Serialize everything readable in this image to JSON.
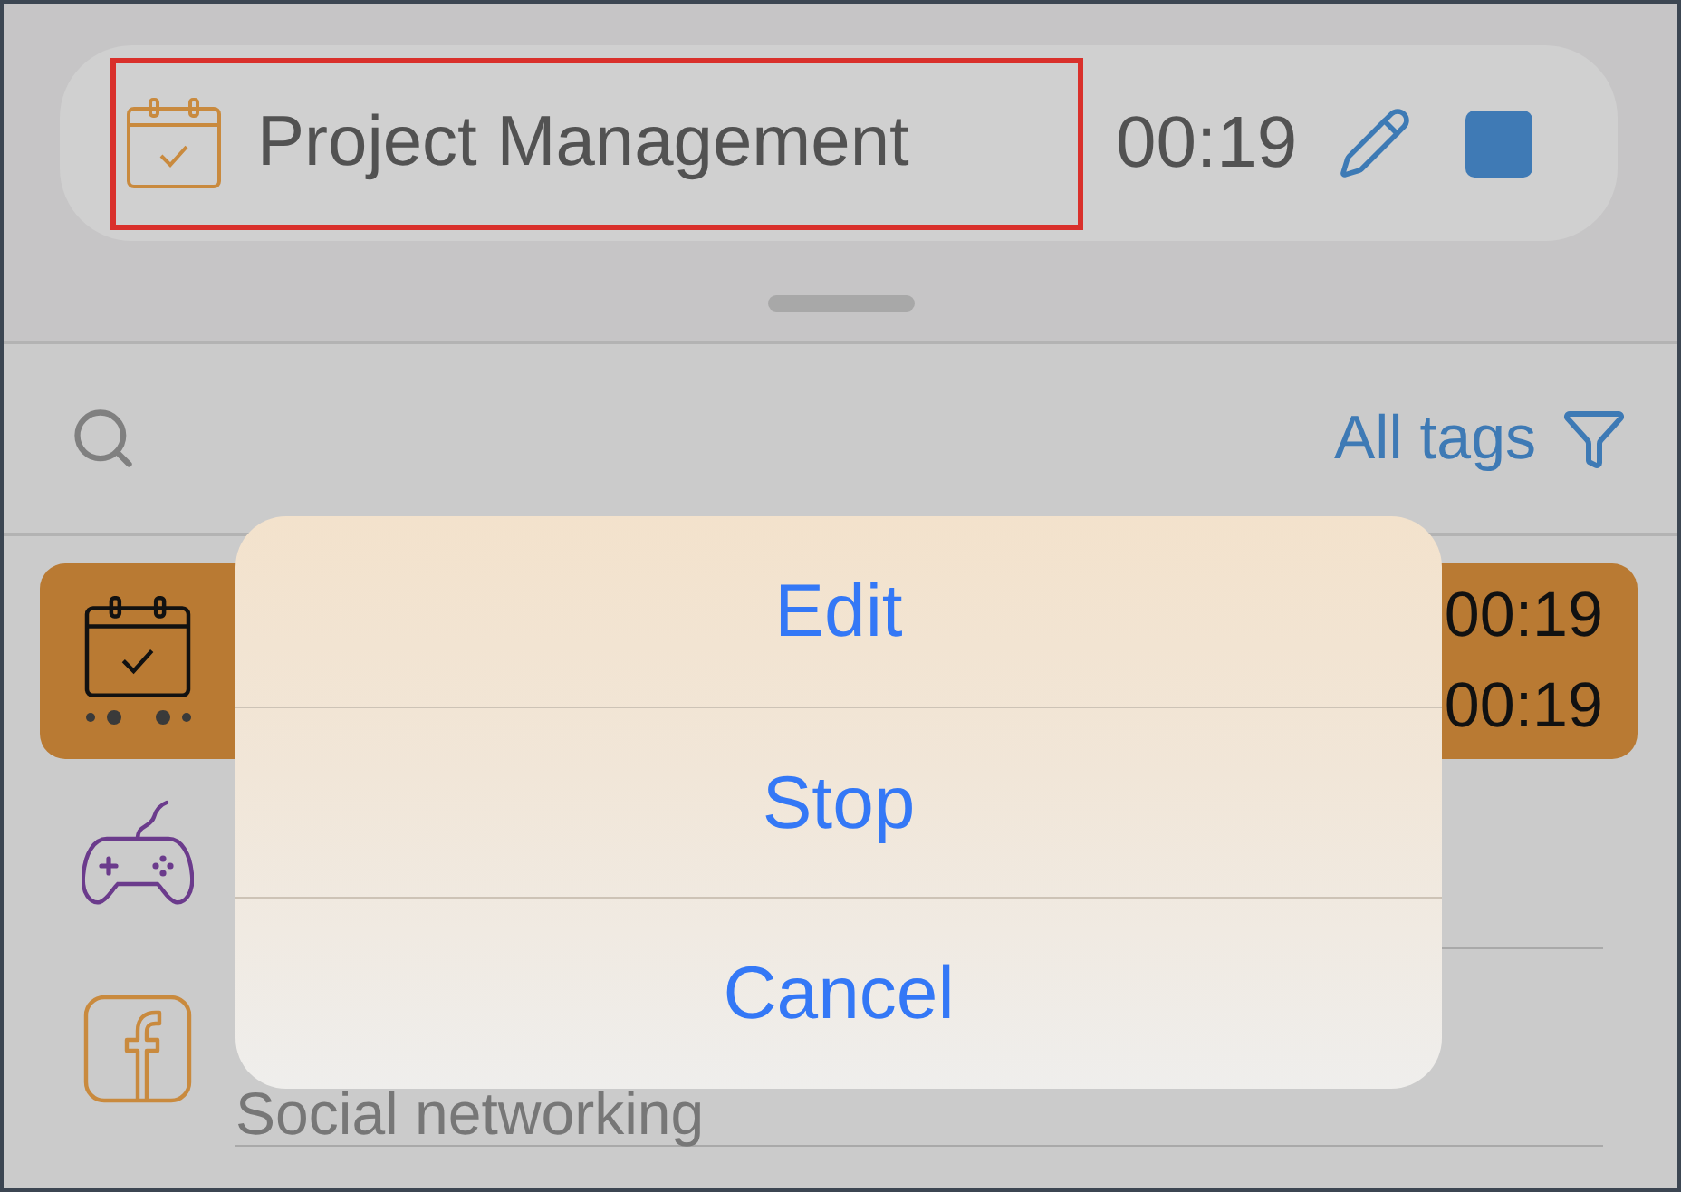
{
  "timer": {
    "title": "Project Management",
    "elapsed": "00:19",
    "highlighted": true
  },
  "filter_bar": {
    "tags_label": "All tags"
  },
  "activities": [
    {
      "kind": "calendar",
      "selected": true,
      "times": [
        "00:19",
        "00:19"
      ]
    },
    {
      "kind": "gamepad",
      "selected": false
    },
    {
      "kind": "social",
      "selected": false,
      "subtitle": "Social networking"
    }
  ],
  "action_sheet": {
    "actions": [
      "Edit",
      "Stop",
      "Cancel"
    ]
  }
}
